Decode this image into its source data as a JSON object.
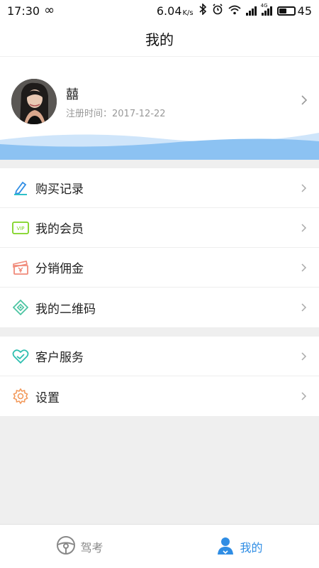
{
  "status_bar": {
    "time": "17:30",
    "speed": "6.04",
    "speed_unit": "K/s",
    "battery": "45",
    "network_label": "4G"
  },
  "header": {
    "title": "我的"
  },
  "profile": {
    "name": "囍",
    "registration": "注册时间：2017-12-22"
  },
  "menu_groups": [
    {
      "items": [
        {
          "label": "购买记录",
          "icon": "pen-edit-icon"
        },
        {
          "label": "我的会员",
          "icon": "vip-card-icon"
        },
        {
          "label": "分销佣金",
          "icon": "commission-ticket-icon"
        },
        {
          "label": "我的二维码",
          "icon": "qr-code-icon"
        }
      ]
    },
    {
      "items": [
        {
          "label": "客户服务",
          "icon": "heart-service-icon"
        },
        {
          "label": "设置",
          "icon": "gear-icon"
        }
      ]
    }
  ],
  "bottom_nav": {
    "items": [
      {
        "label": "驾考",
        "icon": "steering-wheel-icon",
        "active": false
      },
      {
        "label": "我的",
        "icon": "user-icon",
        "active": true
      }
    ]
  },
  "colors": {
    "accent": "#2f8de4",
    "wave_light": "#b7d9f7",
    "wave_dark": "#8cc2f2"
  }
}
